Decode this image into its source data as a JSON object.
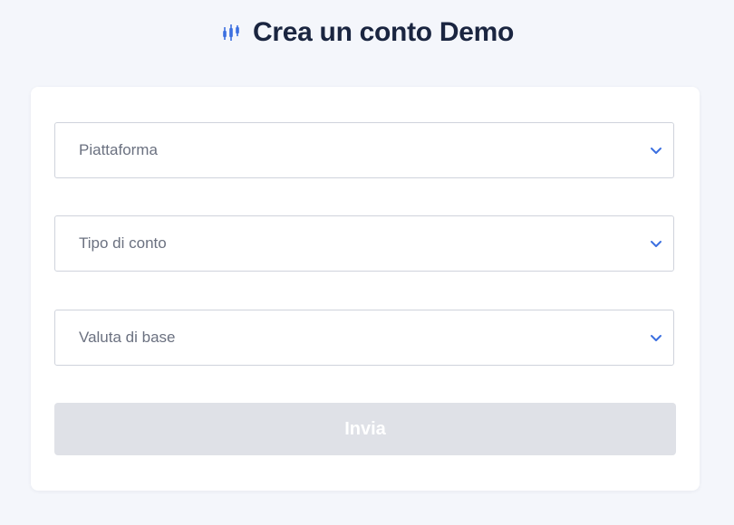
{
  "header": {
    "title": "Crea un conto Demo",
    "icon": "candlestick-chart-icon",
    "icon_color": "#3b6fe0"
  },
  "form": {
    "fields": [
      {
        "placeholder": "Piattaforma",
        "icon": "chevron-down-icon"
      },
      {
        "placeholder": "Tipo di conto",
        "icon": "chevron-down-icon"
      },
      {
        "placeholder": "Valuta di base",
        "icon": "chevron-down-icon"
      }
    ],
    "submit_label": "Invia",
    "submit_state": "disabled"
  },
  "colors": {
    "background": "#f4f6fb",
    "card": "#ffffff",
    "title": "#1a2540",
    "accent": "#3b6fe0",
    "button_disabled": "#dfe1e7"
  }
}
